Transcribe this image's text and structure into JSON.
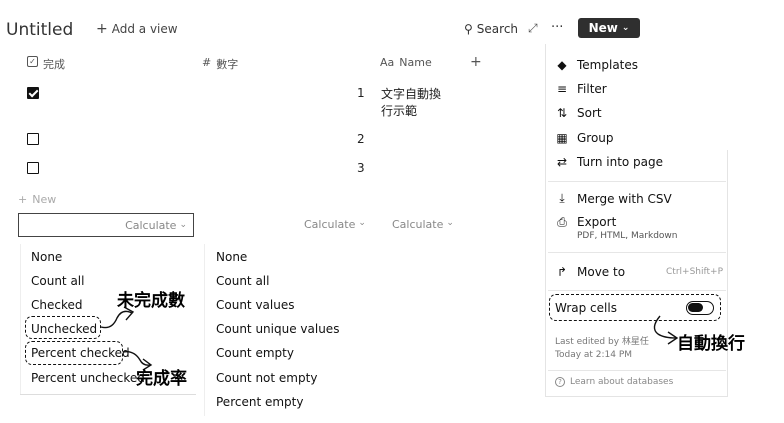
{
  "header": {
    "title": "Untitled",
    "add_view": "Add a view",
    "search": "Search",
    "more": "···",
    "new_button": "New"
  },
  "columns": [
    {
      "icon": "checkbox-icon",
      "label": "完成"
    },
    {
      "icon": "number-icon",
      "label": "數字"
    },
    {
      "icon": "text-icon",
      "label": "Name"
    }
  ],
  "add_column": "+",
  "rows": [
    {
      "checked": true,
      "number": "1",
      "name_line1": "文字自動換",
      "name_line2": "行示範"
    },
    {
      "checked": false,
      "number": "2",
      "name_line1": "",
      "name_line2": ""
    },
    {
      "checked": false,
      "number": "3",
      "name_line1": "",
      "name_line2": ""
    }
  ],
  "new_row": "New",
  "calculate": {
    "col1": "Calculate",
    "col2": "Calculate",
    "col3": "Calculate"
  },
  "calc_menu_checkbox": [
    "None",
    "Count all",
    "Checked",
    "Unchecked",
    "Percent checked",
    "Percent unchecked"
  ],
  "calc_menu_number": [
    "None",
    "Count all",
    "Count values",
    "Count unique values",
    "Count empty",
    "Count not empty",
    "Percent empty"
  ],
  "side_menu": {
    "templates": "Templates",
    "filter": "Filter",
    "sort": "Sort",
    "group": "Group",
    "turn_into_page": "Turn into page",
    "merge_csv": "Merge with CSV",
    "export": "Export",
    "export_sub": "PDF, HTML, Markdown",
    "move_to": "Move to",
    "move_to_shortcut": "Ctrl+Shift+P",
    "wrap_cells": "Wrap cells",
    "last_edited": "Last edited by 林星任",
    "last_edited_time": "Today at 2:14 PM",
    "learn": "Learn about databases"
  },
  "annotations": {
    "unchecked_note": "未完成數",
    "percent_note": "完成率",
    "wrap_note": "自動換行"
  }
}
